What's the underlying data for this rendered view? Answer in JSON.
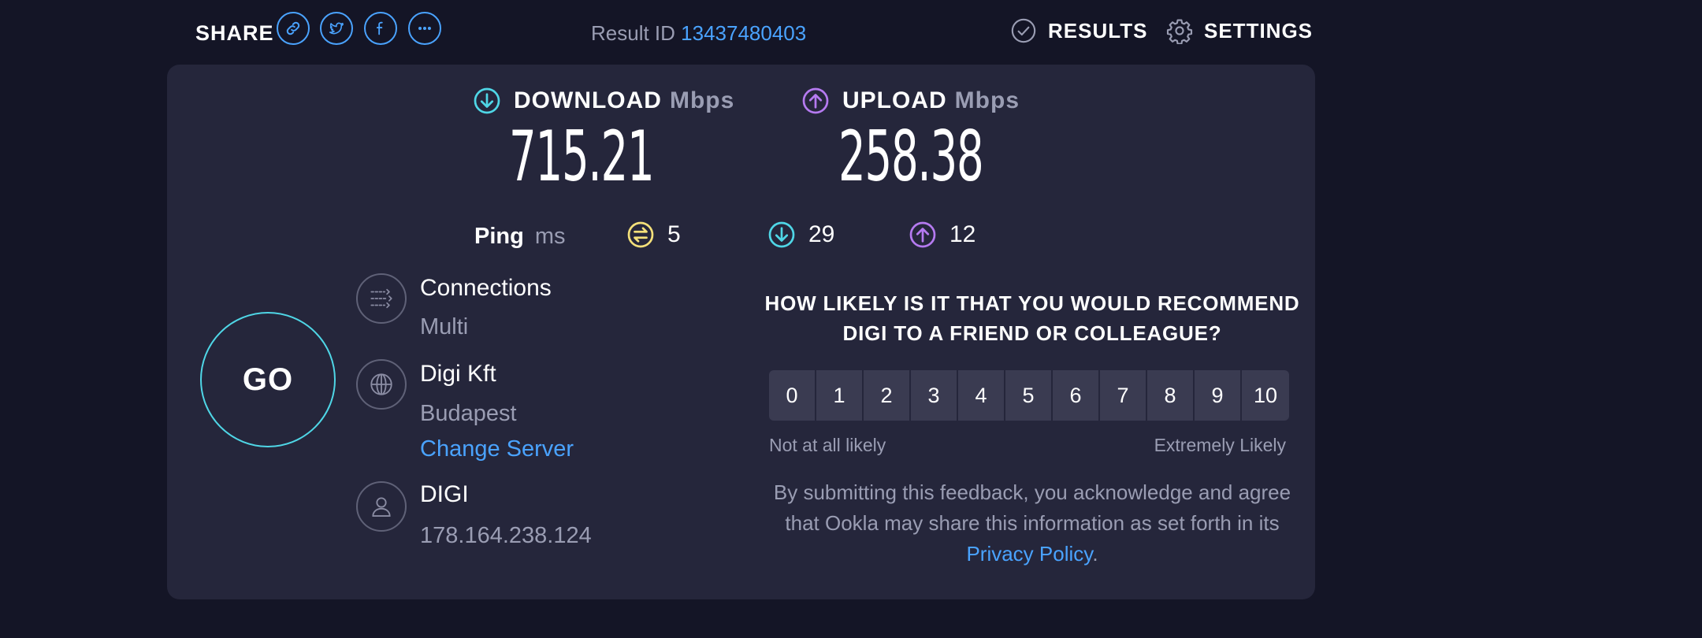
{
  "header": {
    "share_label": "SHARE",
    "share_buttons": [
      {
        "icon": "link-icon"
      },
      {
        "icon": "twitter-icon"
      },
      {
        "icon": "facebook-icon"
      },
      {
        "icon": "more-icon"
      }
    ],
    "result_label": "Result ID",
    "result_id": "13437480403",
    "nav": {
      "results_label": "RESULTS",
      "settings_label": "SETTINGS"
    }
  },
  "speeds": {
    "download": {
      "label": "DOWNLOAD",
      "unit": "Mbps",
      "value": "715.21",
      "color": "#4fd6e6"
    },
    "upload": {
      "label": "UPLOAD",
      "unit": "Mbps",
      "value": "258.38",
      "color": "#b57af0"
    }
  },
  "ping": {
    "label": "Ping",
    "unit": "ms",
    "idle": {
      "value": "5",
      "color": "#f4e07a"
    },
    "download": {
      "value": "29",
      "color": "#4fd6e6"
    },
    "upload": {
      "value": "12",
      "color": "#b57af0"
    }
  },
  "go_label": "GO",
  "connections": {
    "title": "Connections",
    "value": "Multi"
  },
  "server": {
    "name": "Digi Kft",
    "location": "Budapest",
    "change_label": "Change Server"
  },
  "isp": {
    "name": "DIGI",
    "ip": "178.164.238.124"
  },
  "survey": {
    "question": "HOW LIKELY IS IT THAT YOU WOULD RECOMMEND DIGI TO A FRIEND OR COLLEAGUE?",
    "scale": [
      "0",
      "1",
      "2",
      "3",
      "4",
      "5",
      "6",
      "7",
      "8",
      "9",
      "10"
    ],
    "low_label": "Not at all likely",
    "high_label": "Extremely Likely",
    "disclaimer_text": "By submitting this feedback, you acknowledge and agree that Ookla may share this information as set forth in its ",
    "privacy_label": "Privacy Policy",
    "disclaimer_end": "."
  },
  "colors": {
    "background": "#141526",
    "card": "#25263b",
    "accent_blue": "#4aa3ff",
    "muted_text": "#9a9db3"
  }
}
